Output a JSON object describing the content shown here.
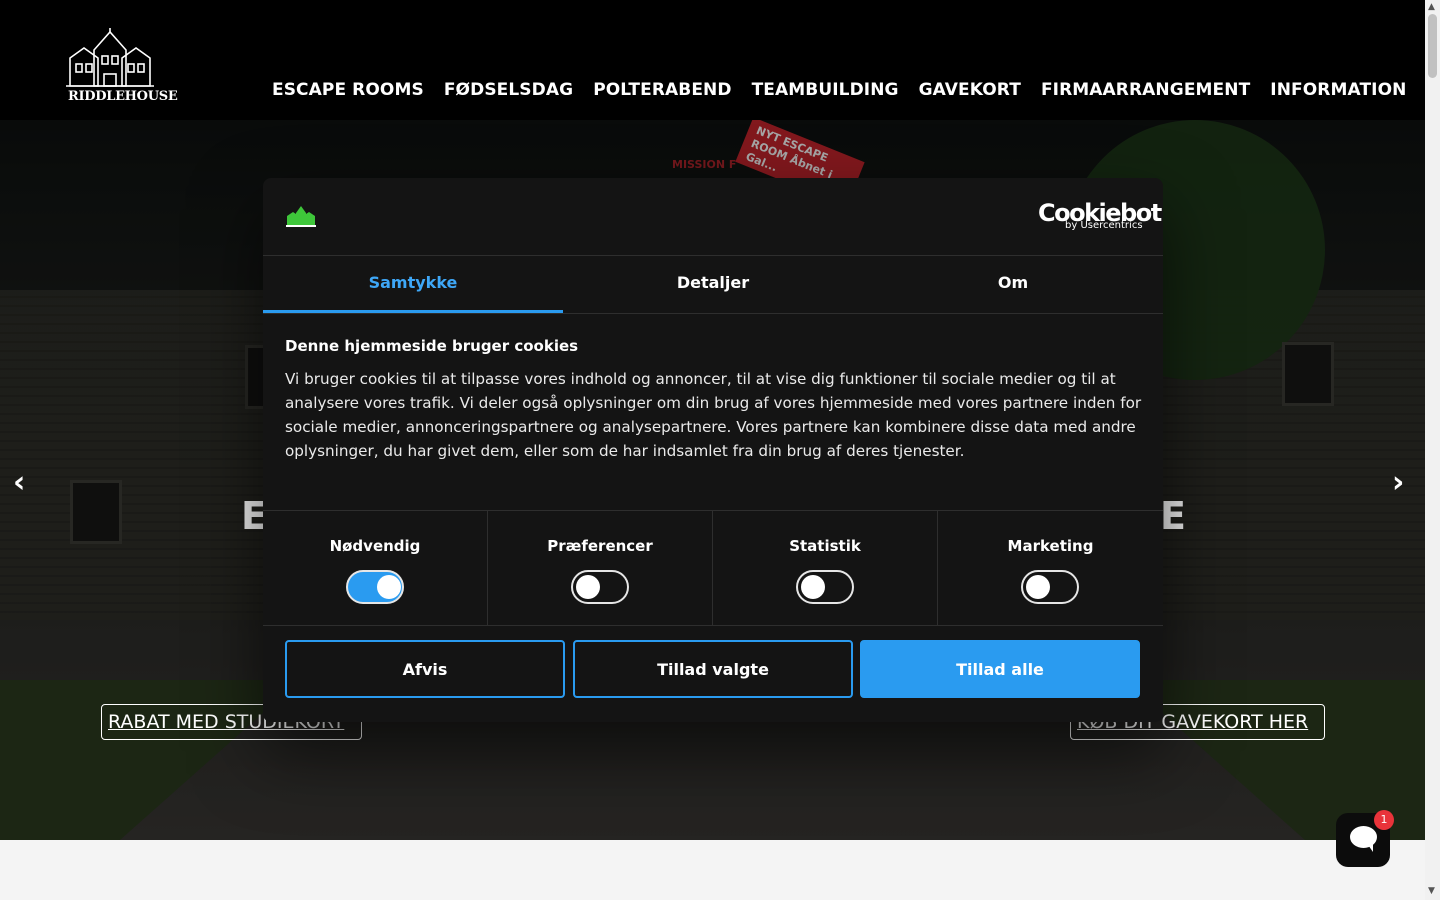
{
  "header": {
    "logo_text": "RIDDLEHOUSE",
    "nav": [
      "ESCAPE ROOMS",
      "FØDSELSDAG",
      "POLTERABEND",
      "TEAMBUILDING",
      "GAVEKORT",
      "FIRMAARRANGEMENT",
      "INFORMATION",
      "..."
    ]
  },
  "hero": {
    "sign_text": "NYT ESCAPE ROOM Åbnet i Gal...",
    "mission_text": "MISSION F",
    "big_left": "E",
    "big_right": "E",
    "arrow_left": "‹",
    "arrow_right": "›",
    "button_left": "RABAT MED STUDIEKORT",
    "button_right": "KØB DIT GAVEKORT HER"
  },
  "cookie": {
    "brand": "Cookiebot",
    "brand_sub": "by Usercentrics",
    "tabs": [
      "Samtykke",
      "Detaljer",
      "Om"
    ],
    "active_tab": "Samtykke",
    "title": "Denne hjemmeside bruger cookies",
    "body": "Vi bruger cookies til at tilpasse vores indhold og annoncer, til at vise dig funktioner til sociale medier og til at analysere vores trafik. Vi deler også oplysninger om din brug af vores hjemmeside med vores partnere inden for sociale medier, annonceringspartnere og analysepartnere. Vores partnere kan kombinere disse data med andre oplysninger, du har givet dem, eller som de har indsamlet fra din brug af deres tjenester.",
    "categories": [
      {
        "label": "Nødvendig",
        "enabled": true
      },
      {
        "label": "Præferencer",
        "enabled": false
      },
      {
        "label": "Statistik",
        "enabled": false
      },
      {
        "label": "Marketing",
        "enabled": false
      }
    ],
    "buttons": {
      "reject": "Afvis",
      "allow_selected": "Tillad valgte",
      "allow_all": "Tillad alle"
    }
  },
  "chat": {
    "badge_count": "1"
  },
  "colors": {
    "accent": "#2a9bf0",
    "dialog_bg": "#141414",
    "header_bg": "#000000",
    "badge": "#e9333a"
  }
}
